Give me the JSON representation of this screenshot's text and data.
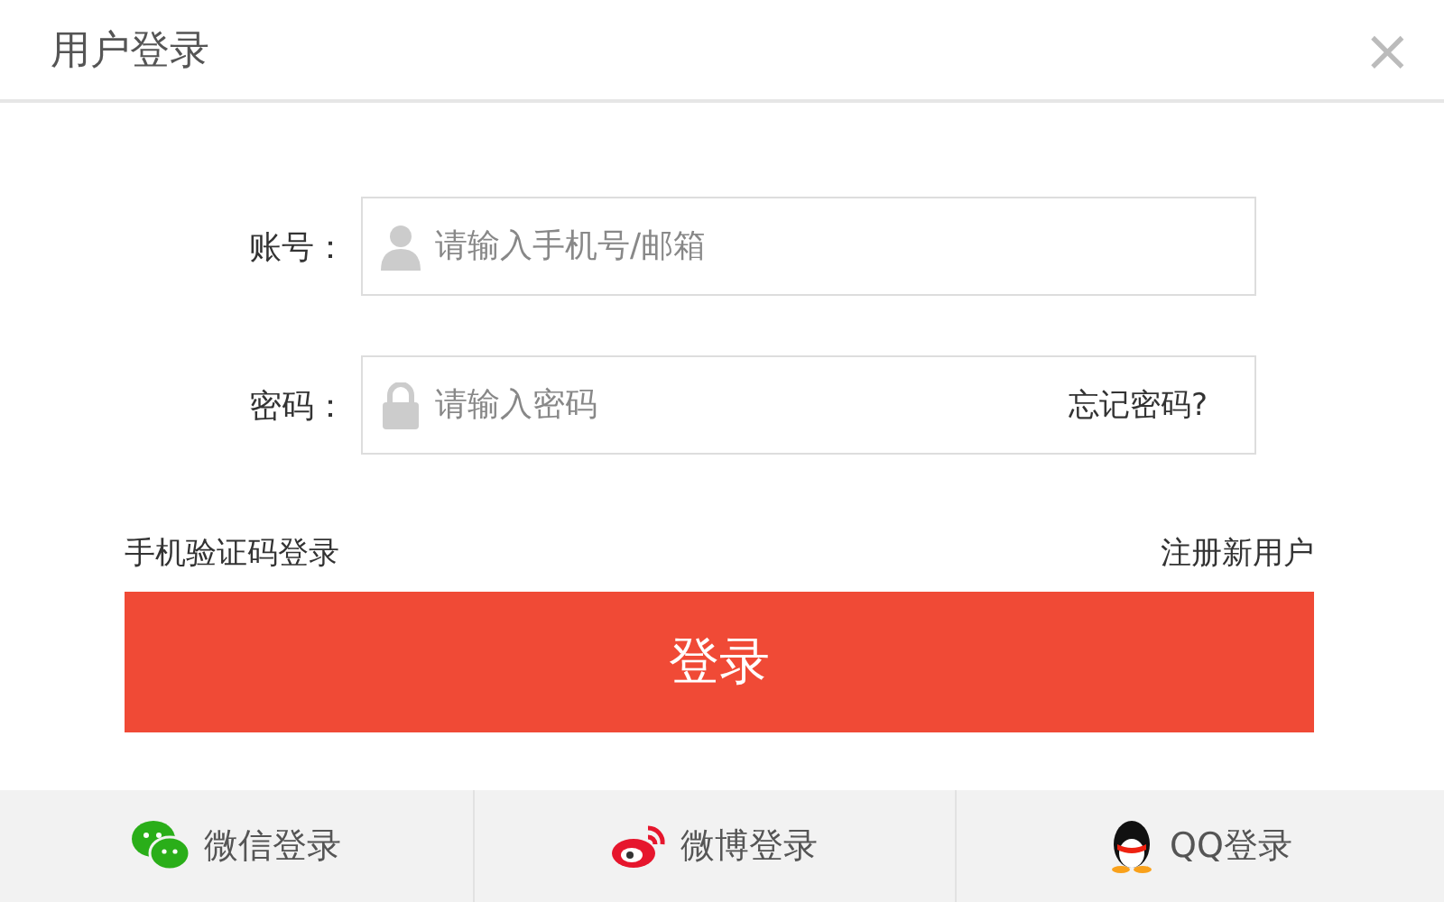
{
  "dialog": {
    "title": "用户登录",
    "close": "×"
  },
  "fields": [
    {
      "kind": "account",
      "label": "账号：",
      "placeholder": "请输入手机号/邮箱"
    },
    {
      "kind": "password",
      "label": "密码：",
      "placeholder": "请输入密码",
      "link": "忘记密码?"
    }
  ],
  "links": {
    "left": "手机验证码登录",
    "right": "注册新用户"
  },
  "submit": "登录",
  "social": [
    {
      "kind": "wechat",
      "label": "微信登录"
    },
    {
      "kind": "weibo",
      "label": "微博登录"
    },
    {
      "kind": "qq",
      "label": "QQ登录"
    }
  ]
}
